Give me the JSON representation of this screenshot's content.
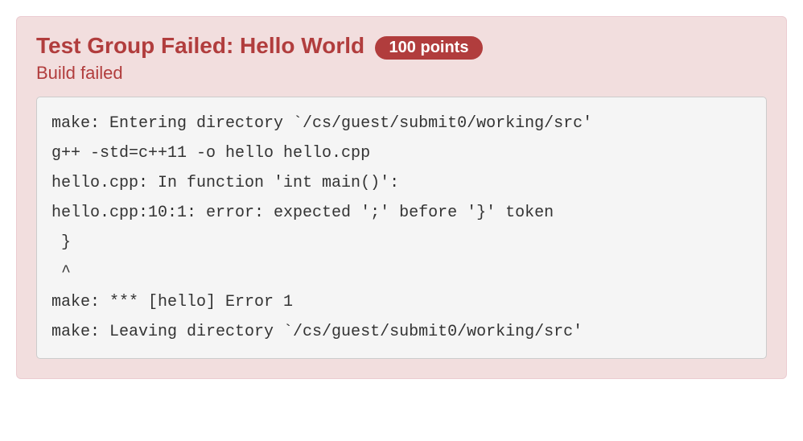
{
  "panel": {
    "title": "Test Group Failed: Hello World",
    "points": "100 points",
    "subtitle": "Build failed",
    "output": "make: Entering directory `/cs/guest/submit0/working/src'\ng++ -std=c++11 -o hello hello.cpp\nhello.cpp: In function 'int main()':\nhello.cpp:10:1: error: expected ';' before '}' token\n }\n ^\nmake: *** [hello] Error 1\nmake: Leaving directory `/cs/guest/submit0/working/src'"
  }
}
